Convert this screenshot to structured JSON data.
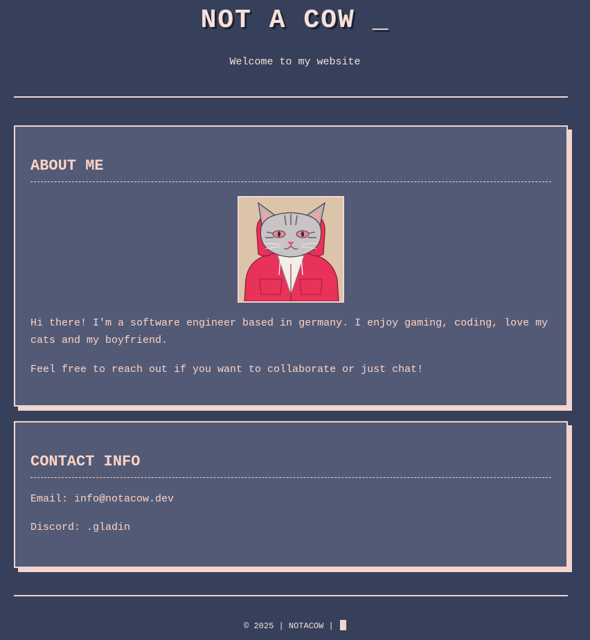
{
  "header": {
    "title": "NOT A COW _",
    "subtitle": "Welcome to my website"
  },
  "about": {
    "heading": "ABOUT ME",
    "avatar_icon": "cat-in-hoodie-avatar",
    "bio": [
      "Hi there! I'm a software engineer based in germany. I enjoy gaming, coding, love my cats and my boyfriend.",
      "Feel free to reach out if you want to collaborate or just chat!"
    ]
  },
  "contact": {
    "heading": "CONTACT INFO",
    "email": "Email: info@notacow.dev",
    "discord": "Discord: .gladin"
  },
  "footer": {
    "text": "© 2025 | NOTACOW | "
  },
  "colors": {
    "background": "#36405a",
    "card": "#525a76",
    "accent": "#f3d5d0",
    "heading": "#ffd3c4",
    "hoodie": "#e8325a"
  }
}
